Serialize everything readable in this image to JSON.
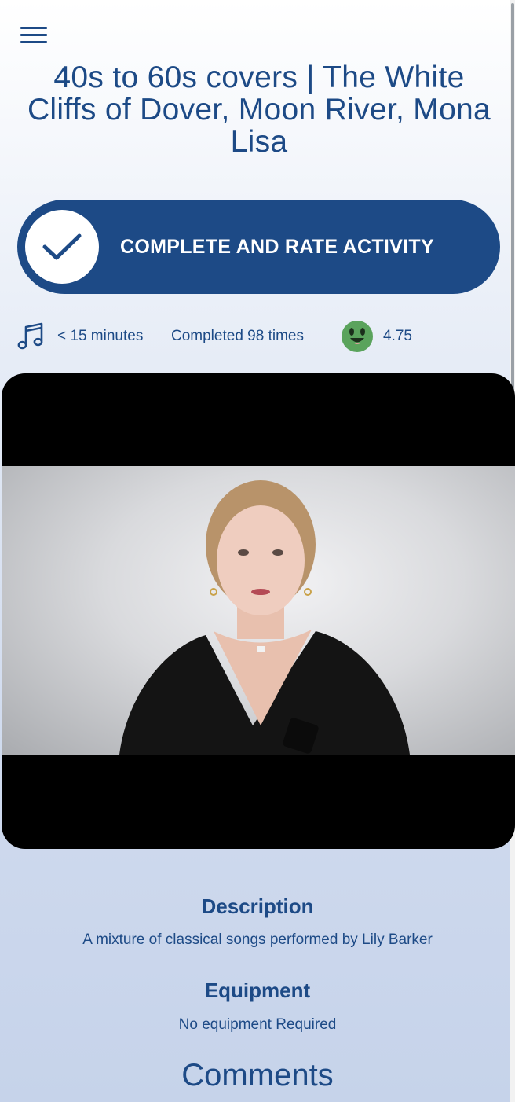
{
  "header": {
    "menu_icon": "hamburger-menu-icon",
    "title": "40s to 60s covers | The White Cliffs of Dover, Moon River, Mona Lisa"
  },
  "cta": {
    "label": "COMPLETE AND RATE ACTIVITY",
    "icon": "checkmark-icon"
  },
  "stats": {
    "category_icon": "music-note-icon",
    "duration": "< 15 minutes",
    "completed": "Completed 98 times",
    "rating_icon": "smiley-face-icon",
    "rating": "4.75"
  },
  "video": {
    "thumbnail": "singer-video-thumbnail"
  },
  "description": {
    "heading": "Description",
    "text": "A mixture of classical songs performed by Lily Barker"
  },
  "equipment": {
    "heading": "Equipment",
    "text": "No equipment Required"
  },
  "comments": {
    "heading": "Comments"
  },
  "colors": {
    "primary": "#1d4a86",
    "rating_green": "#5aa35c",
    "background": "#dde5f3"
  }
}
